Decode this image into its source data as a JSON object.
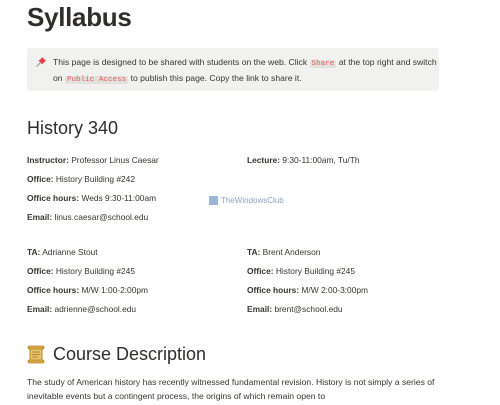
{
  "page": {
    "title": "Syllabus"
  },
  "callout": {
    "icon": "pushpin-icon",
    "text_1": "This page is designed to be shared with students on the web. Click ",
    "code_1": "Share",
    "text_2": " at the top right and switch on ",
    "code_2": "Public Access",
    "text_3": " to publish this page. Copy the link to share it."
  },
  "course": {
    "heading": "History 340",
    "instructor": {
      "label": "Instructor:",
      "value": " Professor Linus Caesar"
    },
    "lecture": {
      "label": "Lecture:",
      "value": " 9:30-11:00am, Tu/Th"
    },
    "office": {
      "label": "Office:",
      "value": " History Building #242"
    },
    "office_hours": {
      "label": "Office hours:",
      "value": " Weds 9:30-11:00am"
    },
    "email": {
      "label": "Email:",
      "value": " linus.caesar@school.edu"
    }
  },
  "tas": [
    {
      "ta": {
        "label": "TA:",
        "value": " Adrianne Stout"
      },
      "office": {
        "label": "Office:",
        "value": " History Building #245"
      },
      "office_hours": {
        "label": "Office hours:",
        "value": " M/W 1:00-2:00pm"
      },
      "email": {
        "label": "Email:",
        "value": " adrienne@school.edu"
      }
    },
    {
      "ta": {
        "label": "TA:",
        "value": " Brent Anderson"
      },
      "office": {
        "label": "Office:",
        "value": " History Building #245"
      },
      "office_hours": {
        "label": "Office hours:",
        "value": " M/W 2:00-3:00pm"
      },
      "email": {
        "label": "Email:",
        "value": " brent@school.edu"
      }
    }
  ],
  "watermark": {
    "text": "TheWindowsClub"
  },
  "description": {
    "icon": "scroll-icon",
    "heading": "Course Description",
    "text": "The study of American history has recently witnessed fundamental revision. History is not simply a series of inevitable events but a contingent process, the origins of which remain open to"
  },
  "colors": {
    "code_text": "#eb5757",
    "callout_bg": "#f1f1ef",
    "text": "#37352f"
  }
}
